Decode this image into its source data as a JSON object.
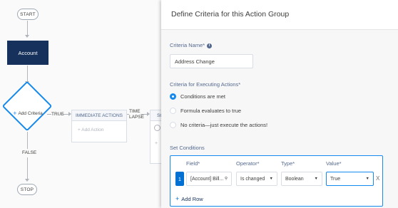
{
  "canvas": {
    "start_label": "START",
    "stop_label": "STOP",
    "object_node": "Account",
    "criteria_node": "Add Criteria",
    "true_label": "TRUE",
    "false_label": "FALSE",
    "immediate_actions_header": "IMMEDIATE ACTIONS",
    "immediate_add_action": "Add Action",
    "time_lapse_line1": "TIME",
    "time_lapse_line2": "LAPSE",
    "scheduled_header_partial": "SCH"
  },
  "panel": {
    "title": "Define Criteria for this Action Group",
    "criteria_name_label": "Criteria Name*",
    "criteria_name_value": "Address Change",
    "executing_label": "Criteria for Executing Actions*",
    "radio_options": [
      {
        "label": "Conditions are met",
        "checked": true
      },
      {
        "label": "Formula evaluates to true",
        "checked": false
      },
      {
        "label": "No criteria—just execute the actions!",
        "checked": false
      }
    ],
    "set_conditions_label": "Set Conditions",
    "columns": {
      "field": "Field*",
      "operator": "Operator*",
      "type": "Type*",
      "value": "Value*"
    },
    "row": {
      "number": "1",
      "field": "[Account] Bill...",
      "operator": "Is changed",
      "type": "Boolean",
      "value": "True"
    },
    "delete_row": "X",
    "add_row": "Add Row"
  },
  "colors": {
    "accent": "#1589ee",
    "node_dark": "#16325c",
    "row_badge": "#0070d2"
  }
}
